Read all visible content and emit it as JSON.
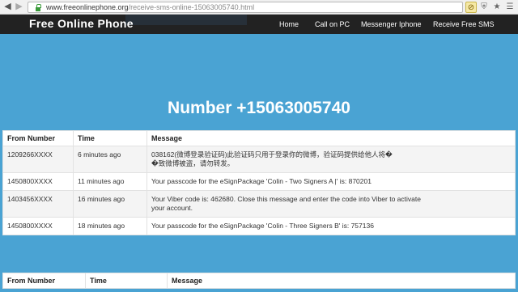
{
  "browser": {
    "url_host": "www.freeonlinephone.org",
    "url_path": "/receive-sms-online-15063005740.html"
  },
  "navbar": {
    "brand": "Free Online Phone",
    "links": [
      "Home",
      "Call on PC",
      "Messenger Iphone",
      "Receive Free SMS"
    ]
  },
  "hero": {
    "title": "Number +15063005740"
  },
  "table": {
    "headers": [
      "From Number",
      "Time",
      "Message"
    ],
    "rows": [
      {
        "from": "1209266XXXX",
        "time": "6 minutes ago",
        "message_line1": "038162(微博登录验证码)此验证码只用于登录你的微博，验证码提供给他人将�",
        "message_line2": "�致微博被盗，请勿转发。"
      },
      {
        "from": "1450800XXXX",
        "time": "11 minutes ago",
        "message_line1": "Your passcode for the eSignPackage 'Colin - Two Signers A |' is: 870201",
        "message_line2": ""
      },
      {
        "from": "1403456XXXX",
        "time": "16 minutes ago",
        "message_line1": "Your Viber code is: 462680. Close this message and enter the code into Viber to activate",
        "message_line2": "your account."
      },
      {
        "from": "1450800XXXX",
        "time": "18 minutes ago",
        "message_line1": "Your passcode for the eSignPackage 'Colin - Three Signers B' is: 757136",
        "message_line2": ""
      }
    ]
  },
  "table2": {
    "headers": [
      "From Number",
      "Time",
      "Message"
    ]
  },
  "colors": {
    "page_bg": "#4aa3d3",
    "navbar_bg": "#222222",
    "text": "#333333"
  }
}
